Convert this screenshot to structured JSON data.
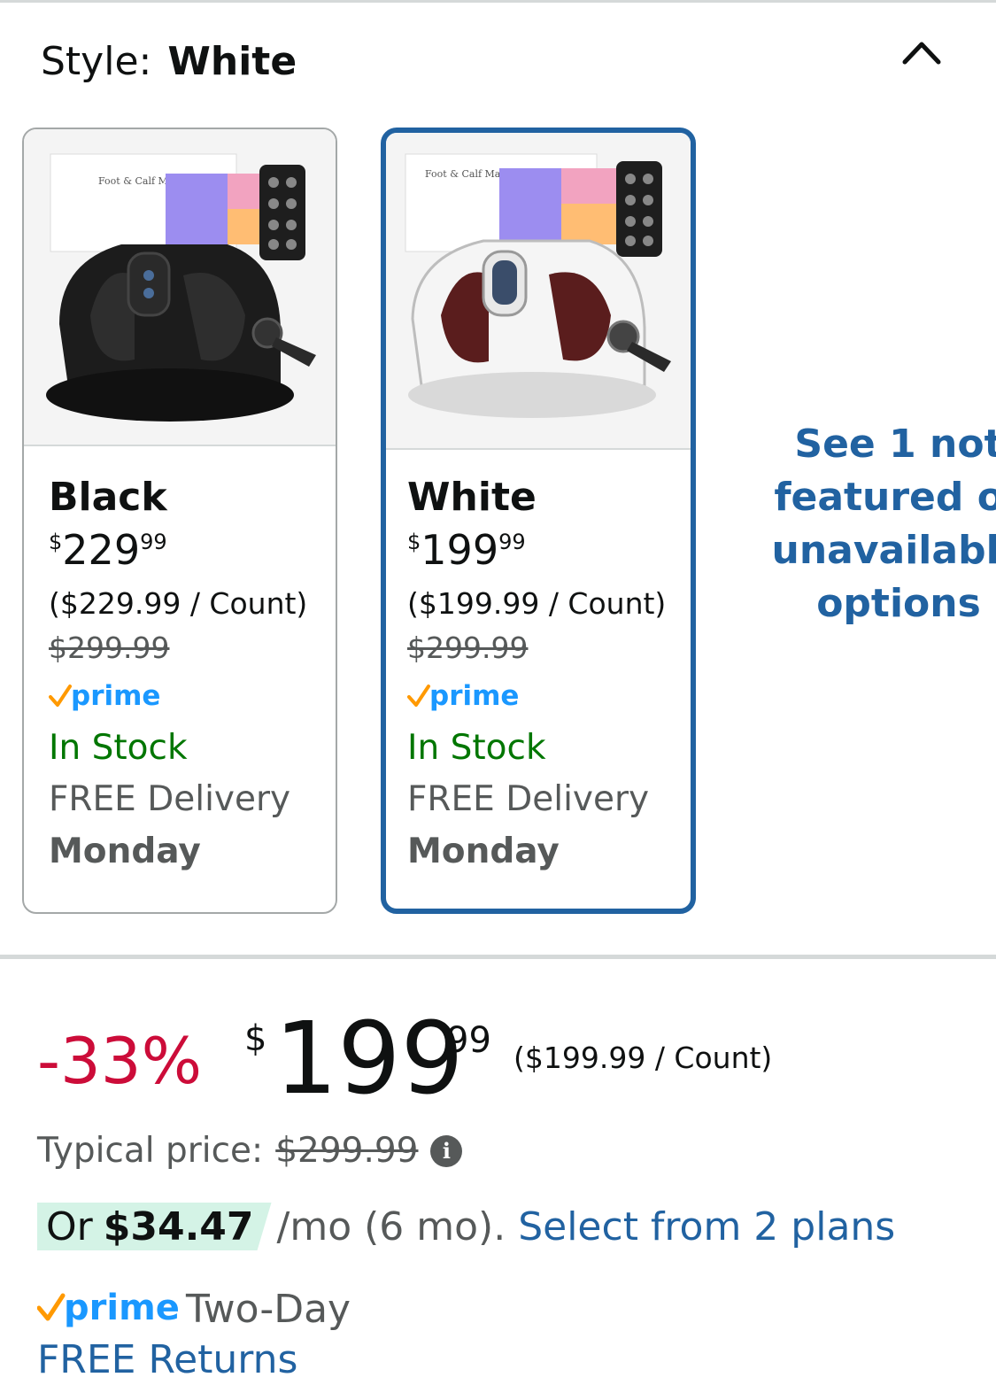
{
  "style_selector": {
    "label": "Style:",
    "value": "White"
  },
  "variants": [
    {
      "name": "Black",
      "price_symbol": "$",
      "price_whole": "229",
      "price_fraction": "99",
      "unit_price": "($229.99 / Count)",
      "list_price": "$299.99",
      "prime": "prime",
      "stock": "In Stock",
      "delivery": "FREE Delivery",
      "delivery_day": "Monday",
      "image_text": "Foot & Calf Massager with Heat",
      "selected": false
    },
    {
      "name": "White",
      "price_symbol": "$",
      "price_whole": "199",
      "price_fraction": "99",
      "unit_price": "($199.99 / Count)",
      "list_price": "$299.99",
      "prime": "prime",
      "stock": "In Stock",
      "delivery": "FREE Delivery",
      "delivery_day": "Monday",
      "image_text": "Foot & Calf Massager with Heat",
      "selected": true
    }
  ],
  "see_more": [
    "See 1 not",
    "featured or",
    "unavailable",
    "options"
  ],
  "price_block": {
    "discount": "-33%",
    "symbol": "$",
    "whole": "199",
    "fraction": "99",
    "unit_price": "($199.99 / Count)",
    "typical_label": "Typical price:",
    "typical_price": "$299.99",
    "info_glyph": "i"
  },
  "installment": {
    "or": "Or",
    "amount": "$34.47",
    "terms": "/mo (6 mo).",
    "link": "Select from 2 plans"
  },
  "delivery": {
    "prime": "prime",
    "two_day": "Two-Day",
    "returns": "FREE Returns"
  },
  "colors": {
    "link_blue": "#2162a1",
    "discount_red": "#cc0c39",
    "stock_green": "#007600",
    "prime_blue": "#1a98ff",
    "prime_check": "#ff9900",
    "installment_bg": "#d4f3e6"
  }
}
